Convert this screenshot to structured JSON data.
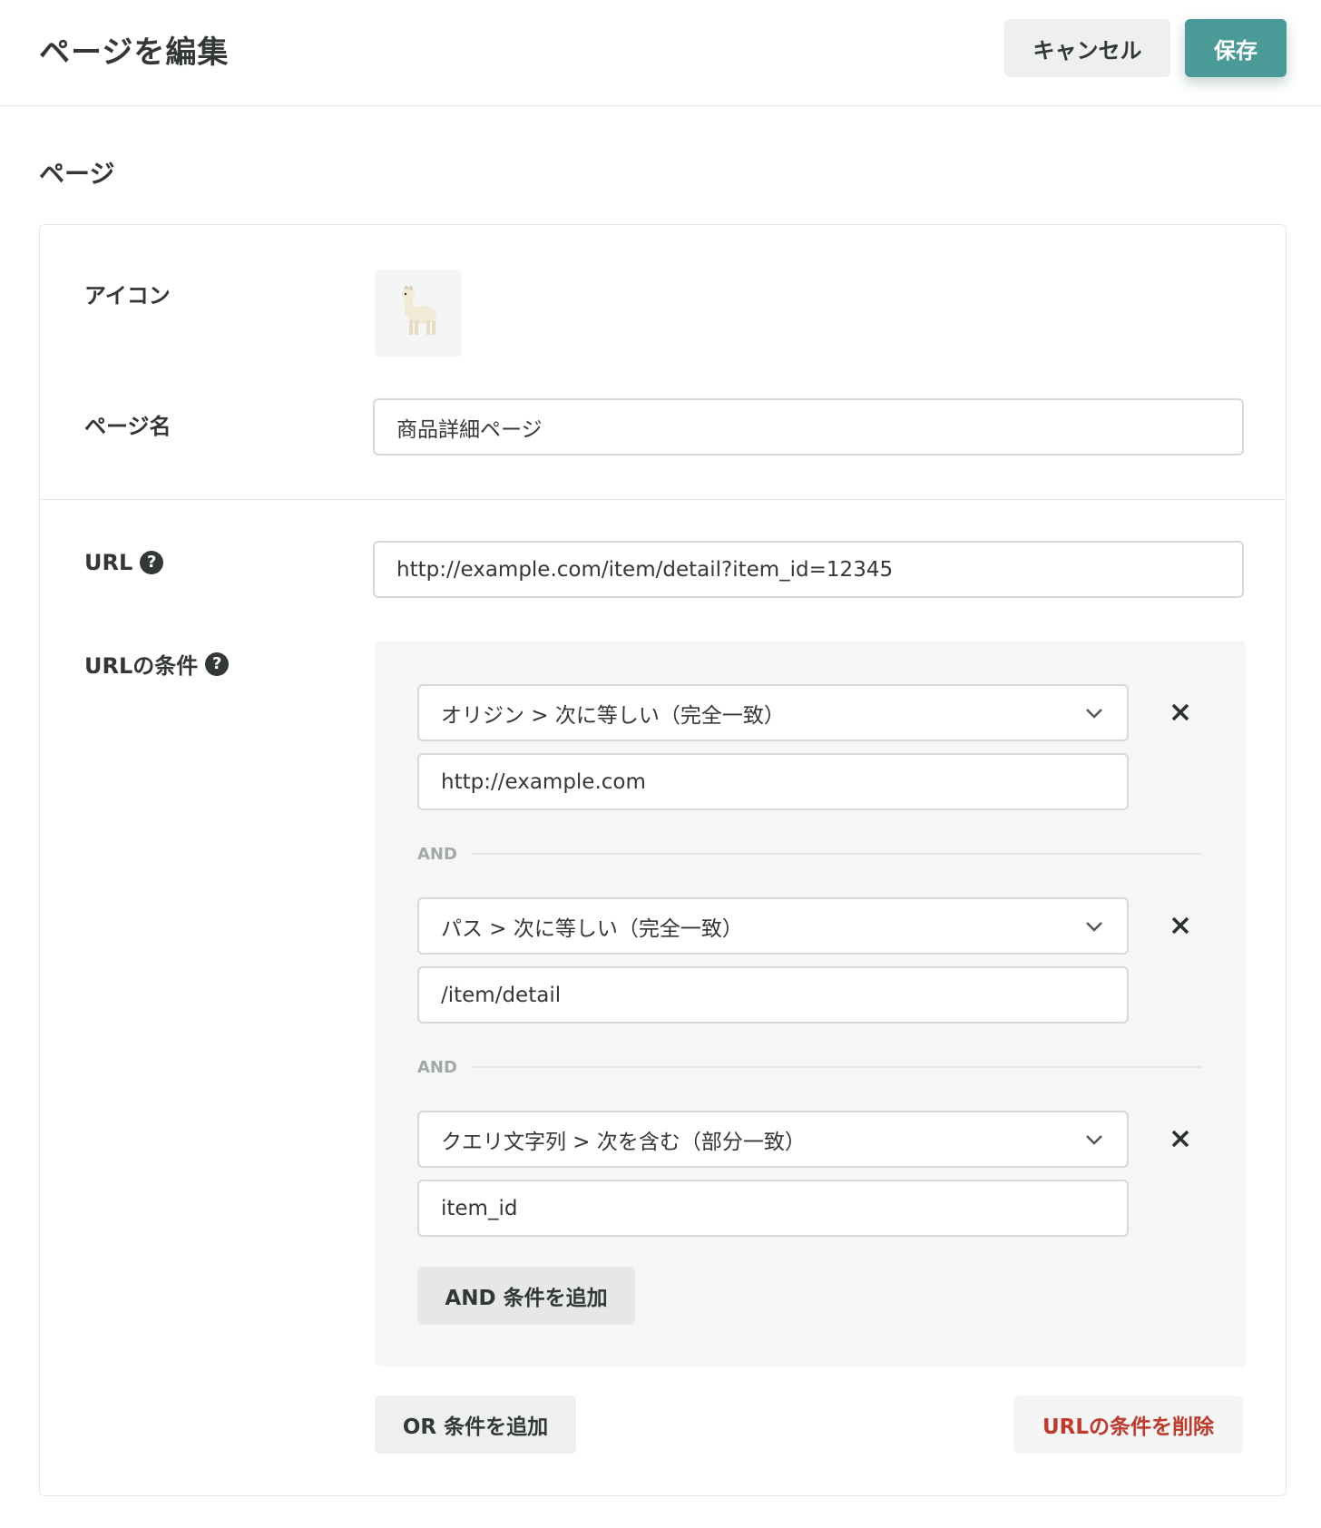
{
  "header": {
    "title": "ページを編集",
    "cancel_label": "キャンセル",
    "save_label": "保存"
  },
  "section": {
    "title": "ページ"
  },
  "form": {
    "icon_label": "アイコン",
    "icon_emoji": "🦙",
    "page_name_label": "ページ名",
    "page_name_value": "商品詳細ページ",
    "url_label": "URL",
    "url_value": "http://example.com/item/detail?item_id=12345",
    "url_conditions_label": "URLの条件",
    "help_glyph": "?",
    "conditions": [
      {
        "type": "オリジン > 次に等しい（完全一致）",
        "value": "http://example.com"
      },
      {
        "type": "パス > 次に等しい（完全一致）",
        "value": "/item/detail"
      },
      {
        "type": "クエリ文字列 > 次を含む（部分一致）",
        "value": "item_id"
      }
    ],
    "and_separator": "AND",
    "add_and_label": "AND 条件を追加",
    "add_or_label": "OR 条件を追加",
    "delete_conditions_label": "URLの条件を削除"
  },
  "colors": {
    "accent": "#4a9a98",
    "danger": "#c0392b",
    "panel_bg": "#f5f6f6",
    "border": "#d6d9d8"
  }
}
